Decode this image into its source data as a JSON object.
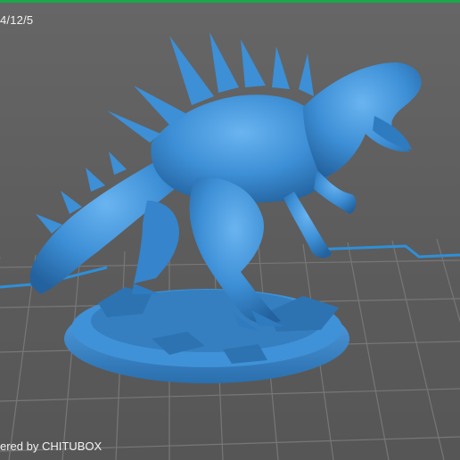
{
  "viewer": {
    "date_label": "4/12/5",
    "watermark": "ered by CHITUBOX"
  },
  "colors": {
    "background": "#5f5f5f",
    "grid_line": "#777777",
    "build_plate_border": "#2f8fd8",
    "model": "#3d8fd6",
    "top_border": "#1aa84a"
  },
  "model": {
    "name_icon": "dinosaur-miniature-model"
  }
}
